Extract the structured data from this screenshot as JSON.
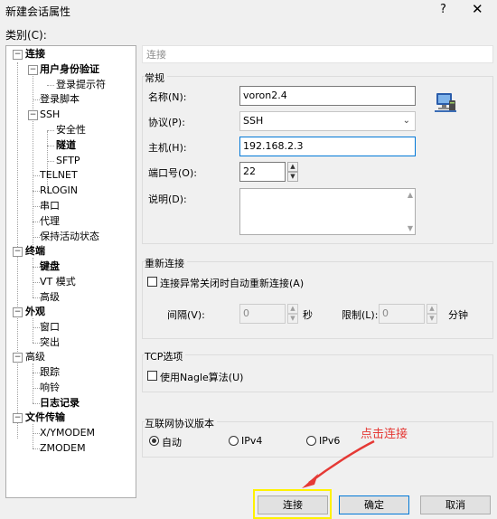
{
  "window": {
    "title": "新建会话属性",
    "help_label": "?",
    "close_label": "✕"
  },
  "category_label": "类别(C):",
  "tree": {
    "connection": "连接",
    "user_auth": "用户身份验证",
    "login_prompt": "登录提示符",
    "login_script": "登录脚本",
    "ssh": "SSH",
    "security": "安全性",
    "tunnel": "隧道",
    "sftp": "SFTP",
    "telnet": "TELNET",
    "rlogin": "RLOGIN",
    "serial": "串口",
    "proxy": "代理",
    "keepalive": "保持活动状态",
    "terminal": "终端",
    "keyboard": "键盘",
    "vt_mode": "VT 模式",
    "term_advanced": "高级",
    "appearance": "外观",
    "window": "窗口",
    "highlight": "突出",
    "advanced": "高级",
    "trace": "跟踪",
    "bell": "响铃",
    "logging": "日志记录",
    "file_transfer": "文件传输",
    "xymodem": "X/YMODEM",
    "zmodem": "ZMODEM",
    "expand_sign": "−"
  },
  "section_header": "连接",
  "general": {
    "title": "常规",
    "name_label": "名称(N):",
    "name_value": "voron2.4",
    "protocol_label": "协议(P):",
    "protocol_value": "SSH",
    "host_label": "主机(H):",
    "host_value": "192.168.2.3",
    "port_label": "端口号(O):",
    "port_value": "22",
    "desc_label": "说明(D):",
    "desc_value": ""
  },
  "reconnect": {
    "title": "重新连接",
    "auto_label": "连接异常关闭时自动重新连接(A)",
    "interval_label": "间隔(V):",
    "interval_value": "0",
    "interval_unit": "秒",
    "limit_label": "限制(L):",
    "limit_value": "0",
    "limit_unit": "分钟"
  },
  "tcp": {
    "title": "TCP选项",
    "nagle_label": "使用Nagle算法(U)"
  },
  "ip_version": {
    "title": "互联网协议版本",
    "auto_label": "自动",
    "ipv4_label": "IPv4",
    "ipv6_label": "IPv6"
  },
  "buttons": {
    "connect": "连接",
    "ok": "确定",
    "cancel": "取消"
  },
  "annotation": "点击连接",
  "colors": {
    "annotation": "#e53935",
    "highlight_box": "#fff200",
    "focus_border": "#0078d7"
  }
}
